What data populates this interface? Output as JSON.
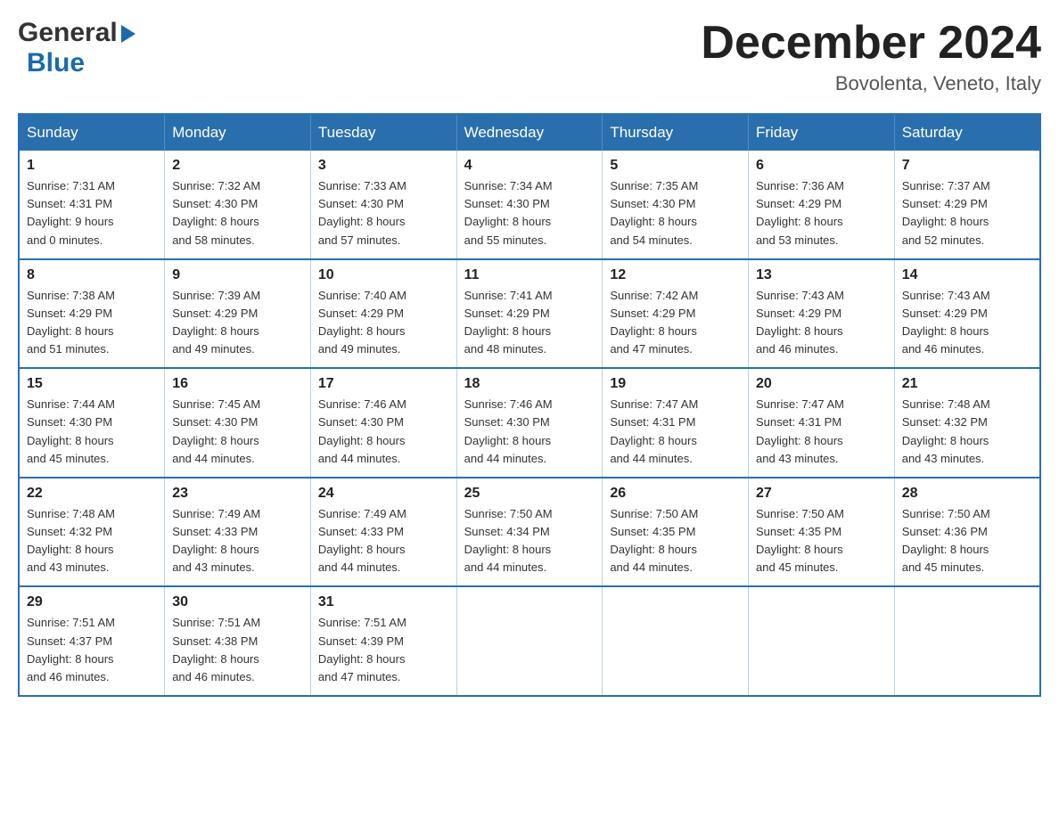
{
  "logo": {
    "general": "General",
    "blue": "Blue",
    "arrow": "▶"
  },
  "title": "December 2024",
  "location": "Bovolenta, Veneto, Italy",
  "days_of_week": [
    "Sunday",
    "Monday",
    "Tuesday",
    "Wednesday",
    "Thursday",
    "Friday",
    "Saturday"
  ],
  "weeks": [
    [
      {
        "day": "1",
        "sunrise": "7:31 AM",
        "sunset": "4:31 PM",
        "daylight": "9 hours and 0 minutes."
      },
      {
        "day": "2",
        "sunrise": "7:32 AM",
        "sunset": "4:30 PM",
        "daylight": "8 hours and 58 minutes."
      },
      {
        "day": "3",
        "sunrise": "7:33 AM",
        "sunset": "4:30 PM",
        "daylight": "8 hours and 57 minutes."
      },
      {
        "day": "4",
        "sunrise": "7:34 AM",
        "sunset": "4:30 PM",
        "daylight": "8 hours and 55 minutes."
      },
      {
        "day": "5",
        "sunrise": "7:35 AM",
        "sunset": "4:30 PM",
        "daylight": "8 hours and 54 minutes."
      },
      {
        "day": "6",
        "sunrise": "7:36 AM",
        "sunset": "4:29 PM",
        "daylight": "8 hours and 53 minutes."
      },
      {
        "day": "7",
        "sunrise": "7:37 AM",
        "sunset": "4:29 PM",
        "daylight": "8 hours and 52 minutes."
      }
    ],
    [
      {
        "day": "8",
        "sunrise": "7:38 AM",
        "sunset": "4:29 PM",
        "daylight": "8 hours and 51 minutes."
      },
      {
        "day": "9",
        "sunrise": "7:39 AM",
        "sunset": "4:29 PM",
        "daylight": "8 hours and 49 minutes."
      },
      {
        "day": "10",
        "sunrise": "7:40 AM",
        "sunset": "4:29 PM",
        "daylight": "8 hours and 49 minutes."
      },
      {
        "day": "11",
        "sunrise": "7:41 AM",
        "sunset": "4:29 PM",
        "daylight": "8 hours and 48 minutes."
      },
      {
        "day": "12",
        "sunrise": "7:42 AM",
        "sunset": "4:29 PM",
        "daylight": "8 hours and 47 minutes."
      },
      {
        "day": "13",
        "sunrise": "7:43 AM",
        "sunset": "4:29 PM",
        "daylight": "8 hours and 46 minutes."
      },
      {
        "day": "14",
        "sunrise": "7:43 AM",
        "sunset": "4:29 PM",
        "daylight": "8 hours and 46 minutes."
      }
    ],
    [
      {
        "day": "15",
        "sunrise": "7:44 AM",
        "sunset": "4:30 PM",
        "daylight": "8 hours and 45 minutes."
      },
      {
        "day": "16",
        "sunrise": "7:45 AM",
        "sunset": "4:30 PM",
        "daylight": "8 hours and 44 minutes."
      },
      {
        "day": "17",
        "sunrise": "7:46 AM",
        "sunset": "4:30 PM",
        "daylight": "8 hours and 44 minutes."
      },
      {
        "day": "18",
        "sunrise": "7:46 AM",
        "sunset": "4:30 PM",
        "daylight": "8 hours and 44 minutes."
      },
      {
        "day": "19",
        "sunrise": "7:47 AM",
        "sunset": "4:31 PM",
        "daylight": "8 hours and 44 minutes."
      },
      {
        "day": "20",
        "sunrise": "7:47 AM",
        "sunset": "4:31 PM",
        "daylight": "8 hours and 43 minutes."
      },
      {
        "day": "21",
        "sunrise": "7:48 AM",
        "sunset": "4:32 PM",
        "daylight": "8 hours and 43 minutes."
      }
    ],
    [
      {
        "day": "22",
        "sunrise": "7:48 AM",
        "sunset": "4:32 PM",
        "daylight": "8 hours and 43 minutes."
      },
      {
        "day": "23",
        "sunrise": "7:49 AM",
        "sunset": "4:33 PM",
        "daylight": "8 hours and 43 minutes."
      },
      {
        "day": "24",
        "sunrise": "7:49 AM",
        "sunset": "4:33 PM",
        "daylight": "8 hours and 44 minutes."
      },
      {
        "day": "25",
        "sunrise": "7:50 AM",
        "sunset": "4:34 PM",
        "daylight": "8 hours and 44 minutes."
      },
      {
        "day": "26",
        "sunrise": "7:50 AM",
        "sunset": "4:35 PM",
        "daylight": "8 hours and 44 minutes."
      },
      {
        "day": "27",
        "sunrise": "7:50 AM",
        "sunset": "4:35 PM",
        "daylight": "8 hours and 45 minutes."
      },
      {
        "day": "28",
        "sunrise": "7:50 AM",
        "sunset": "4:36 PM",
        "daylight": "8 hours and 45 minutes."
      }
    ],
    [
      {
        "day": "29",
        "sunrise": "7:51 AM",
        "sunset": "4:37 PM",
        "daylight": "8 hours and 46 minutes."
      },
      {
        "day": "30",
        "sunrise": "7:51 AM",
        "sunset": "4:38 PM",
        "daylight": "8 hours and 46 minutes."
      },
      {
        "day": "31",
        "sunrise": "7:51 AM",
        "sunset": "4:39 PM",
        "daylight": "8 hours and 47 minutes."
      },
      null,
      null,
      null,
      null
    ]
  ]
}
